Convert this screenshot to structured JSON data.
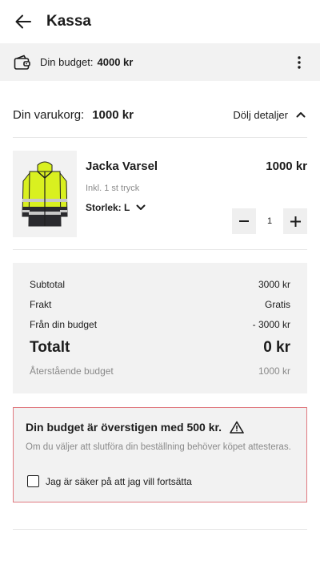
{
  "header": {
    "title": "Kassa",
    "back_icon": "arrow-left-icon"
  },
  "budget": {
    "label": "Din budget:",
    "value": "4000 kr",
    "wallet_icon": "wallet-icon",
    "menu_icon": "more-vertical-icon"
  },
  "cart": {
    "label": "Din varukorg:",
    "value": "1000 kr",
    "toggle_label": "Dölj detaljer",
    "toggle_icon": "chevron-up-icon"
  },
  "product": {
    "name": "Jacka Varsel",
    "price": "1000 kr",
    "subtitle": "Inkl. 1 st tryck",
    "size_label": "Storlek: L",
    "quantity": "1",
    "image": "hi-vis-jacket"
  },
  "summary": {
    "subtotal_label": "Subtotal",
    "subtotal_value": "3000 kr",
    "shipping_label": "Frakt",
    "shipping_value": "Gratis",
    "budget_label": "Från din budget",
    "budget_value": "- 3000 kr",
    "total_label": "Totalt",
    "total_value": "0 kr",
    "remaining_label": "Återstående budget",
    "remaining_value": "1000 kr"
  },
  "warning": {
    "title": "Din budget är överstigen med 500 kr.",
    "body": "Om du väljer att slutföra din beställning behöver köpet attesteras.",
    "checkbox_label": "Jag är säker på att jag vill fortsätta",
    "border_color": "#e07a80"
  }
}
